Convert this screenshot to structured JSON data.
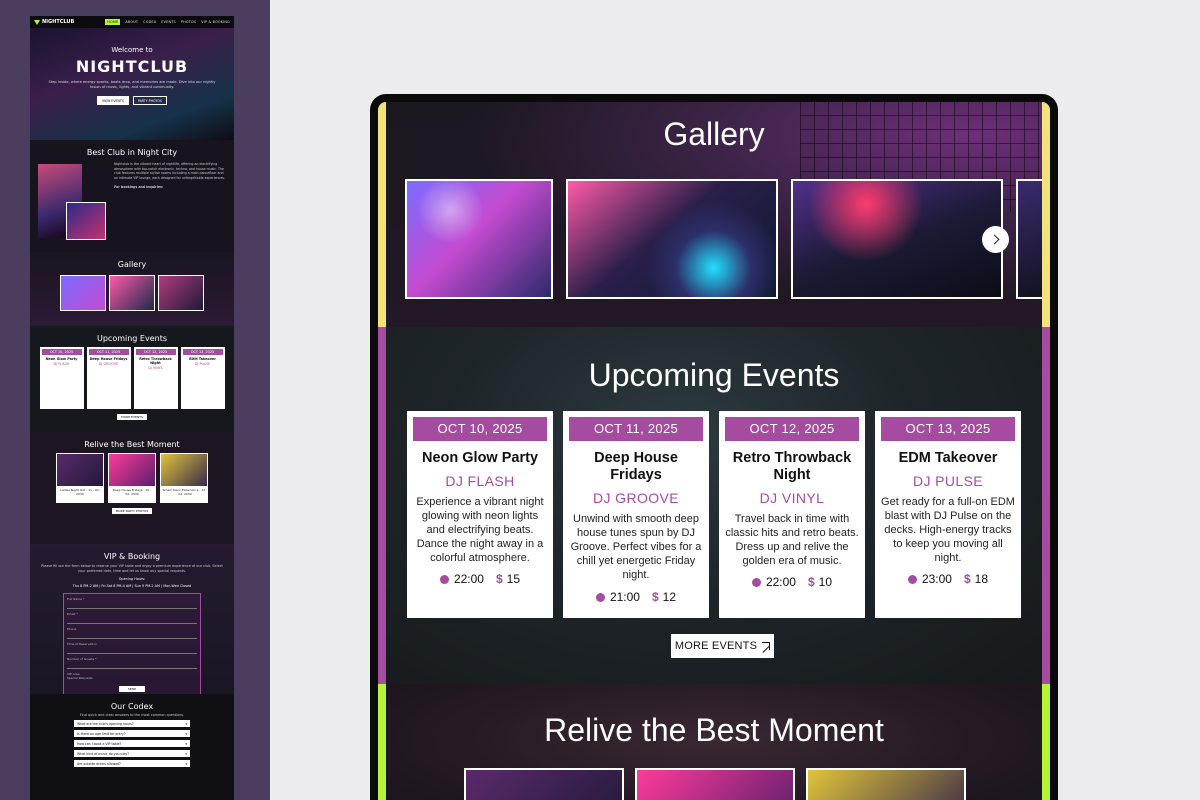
{
  "mini": {
    "logo": "NIGHTCLUB",
    "nav": [
      "HOME",
      "ABOUT",
      "CODEX",
      "EVENTS",
      "PHOTOS",
      "VIP & BOOKING"
    ],
    "hero_welcome": "Welcome to",
    "hero_title": "NIGHTCLUB",
    "hero_text": "Step inside, where energy sparks, beats drop, and memories are made. Dive into our nightly fusion of music, lights, and vibrant community.",
    "btn_events": "VIEW EVENTS",
    "btn_party": "PARTY PHOTOS",
    "about_title": "Best Club in Night City",
    "about_text": "Nightclub is the vibrant heart of nightlife, offering an electrifying atmosphere with top-notch electronic, techno, and house music. The club features multiple stylish rooms including a main dancefloor and an intimate VIP lounge, each designed for unforgettable experiences.",
    "about_contact": "For bookings and inquiries:",
    "gallery_title": "Gallery",
    "events_title": "Upcoming Events",
    "events": [
      {
        "date": "OCT 10, 2025",
        "title": "Neon Glow Party",
        "dj": "DJ FLASH"
      },
      {
        "date": "OCT 11, 2025",
        "title": "Deep House Fridays",
        "dj": "DJ GROOVE"
      },
      {
        "date": "OCT 12, 2025",
        "title": "Retro Throwback Night",
        "dj": "DJ VINYL"
      },
      {
        "date": "OCT 13, 2025",
        "title": "EDM Takeover",
        "dj": "DJ PULSE"
      }
    ],
    "more_events": "MORE EVENTS",
    "relive_title": "Relive the Best Moment",
    "relive_caps": [
      "Ladies Night Out - 11 - 02, 2030",
      "Deep House Fridays - 15 - 02, 2030",
      "Smart Disco Experience - 15 - 02, 2030"
    ],
    "more_photos": "MORE PARTY PHOTOS",
    "vip_title": "VIP & Booking",
    "vip_text": "Please fill out the form below to reserve your VIP table and enjoy a premium experience at our club. Select your preferred date, time and let us know any special requests.",
    "vip_hours_title": "Opening Hours:",
    "vip_hours": "Thu 8 PM-2 AM | Fri-Sat 8 PM-4 AM | Sun 9 PM-2 AM | Mon-Wed Closed",
    "form_fields": [
      "Full Name *",
      "Email *",
      "Phone",
      "Time of Reservation",
      "Number of Guests *",
      "VIP Area",
      "Special Requests"
    ],
    "send": "SEND",
    "codex_title": "Our Codex",
    "codex_text": "Find quick and clear answers to the most common questions.",
    "faq": [
      "What are the club's opening hours?",
      "Is there an age limit for entry?",
      "How can I book a VIP table?",
      "What kind of music do you play?",
      "Are outside drinks allowed?"
    ]
  },
  "gallery": {
    "title": "Gallery"
  },
  "events": {
    "title": "Upcoming Events",
    "cards": [
      {
        "date": "OCT 10, 2025",
        "title": "Neon Glow Party",
        "dj": "DJ FLASH",
        "desc": "Experience a vibrant night glowing with neon lights and electrifying beats. Dance the night away in a colorful atmosphere.",
        "time": "22:00",
        "price": "15"
      },
      {
        "date": "OCT 11, 2025",
        "title": "Deep House Fridays",
        "dj": "DJ GROOVE",
        "desc": "Unwind with smooth deep house tunes spun by DJ Groove. Perfect vibes for a chill yet energetic Friday night.",
        "time": "21:00",
        "price": "12"
      },
      {
        "date": "OCT 12, 2025",
        "title": "Retro Throwback Night",
        "dj": "DJ VINYL",
        "desc": "Travel back in time with classic hits and retro beats. Dress up and relive the golden era of music.",
        "time": "22:00",
        "price": "10"
      },
      {
        "date": "OCT 13, 2025",
        "title": "EDM Takeover",
        "dj": "DJ PULSE",
        "desc": "Get ready for a full-on EDM blast with DJ Pulse on the decks. High-energy tracks to keep you moving all night.",
        "time": "23:00",
        "price": "18"
      }
    ],
    "more_label": "MORE EVENTS"
  },
  "relive": {
    "title": "Relive the Best Moment"
  },
  "colors": {
    "accent_purple": "#a64ca0",
    "accent_lime": "#b6f236",
    "accent_yellow": "#f2e27a"
  }
}
